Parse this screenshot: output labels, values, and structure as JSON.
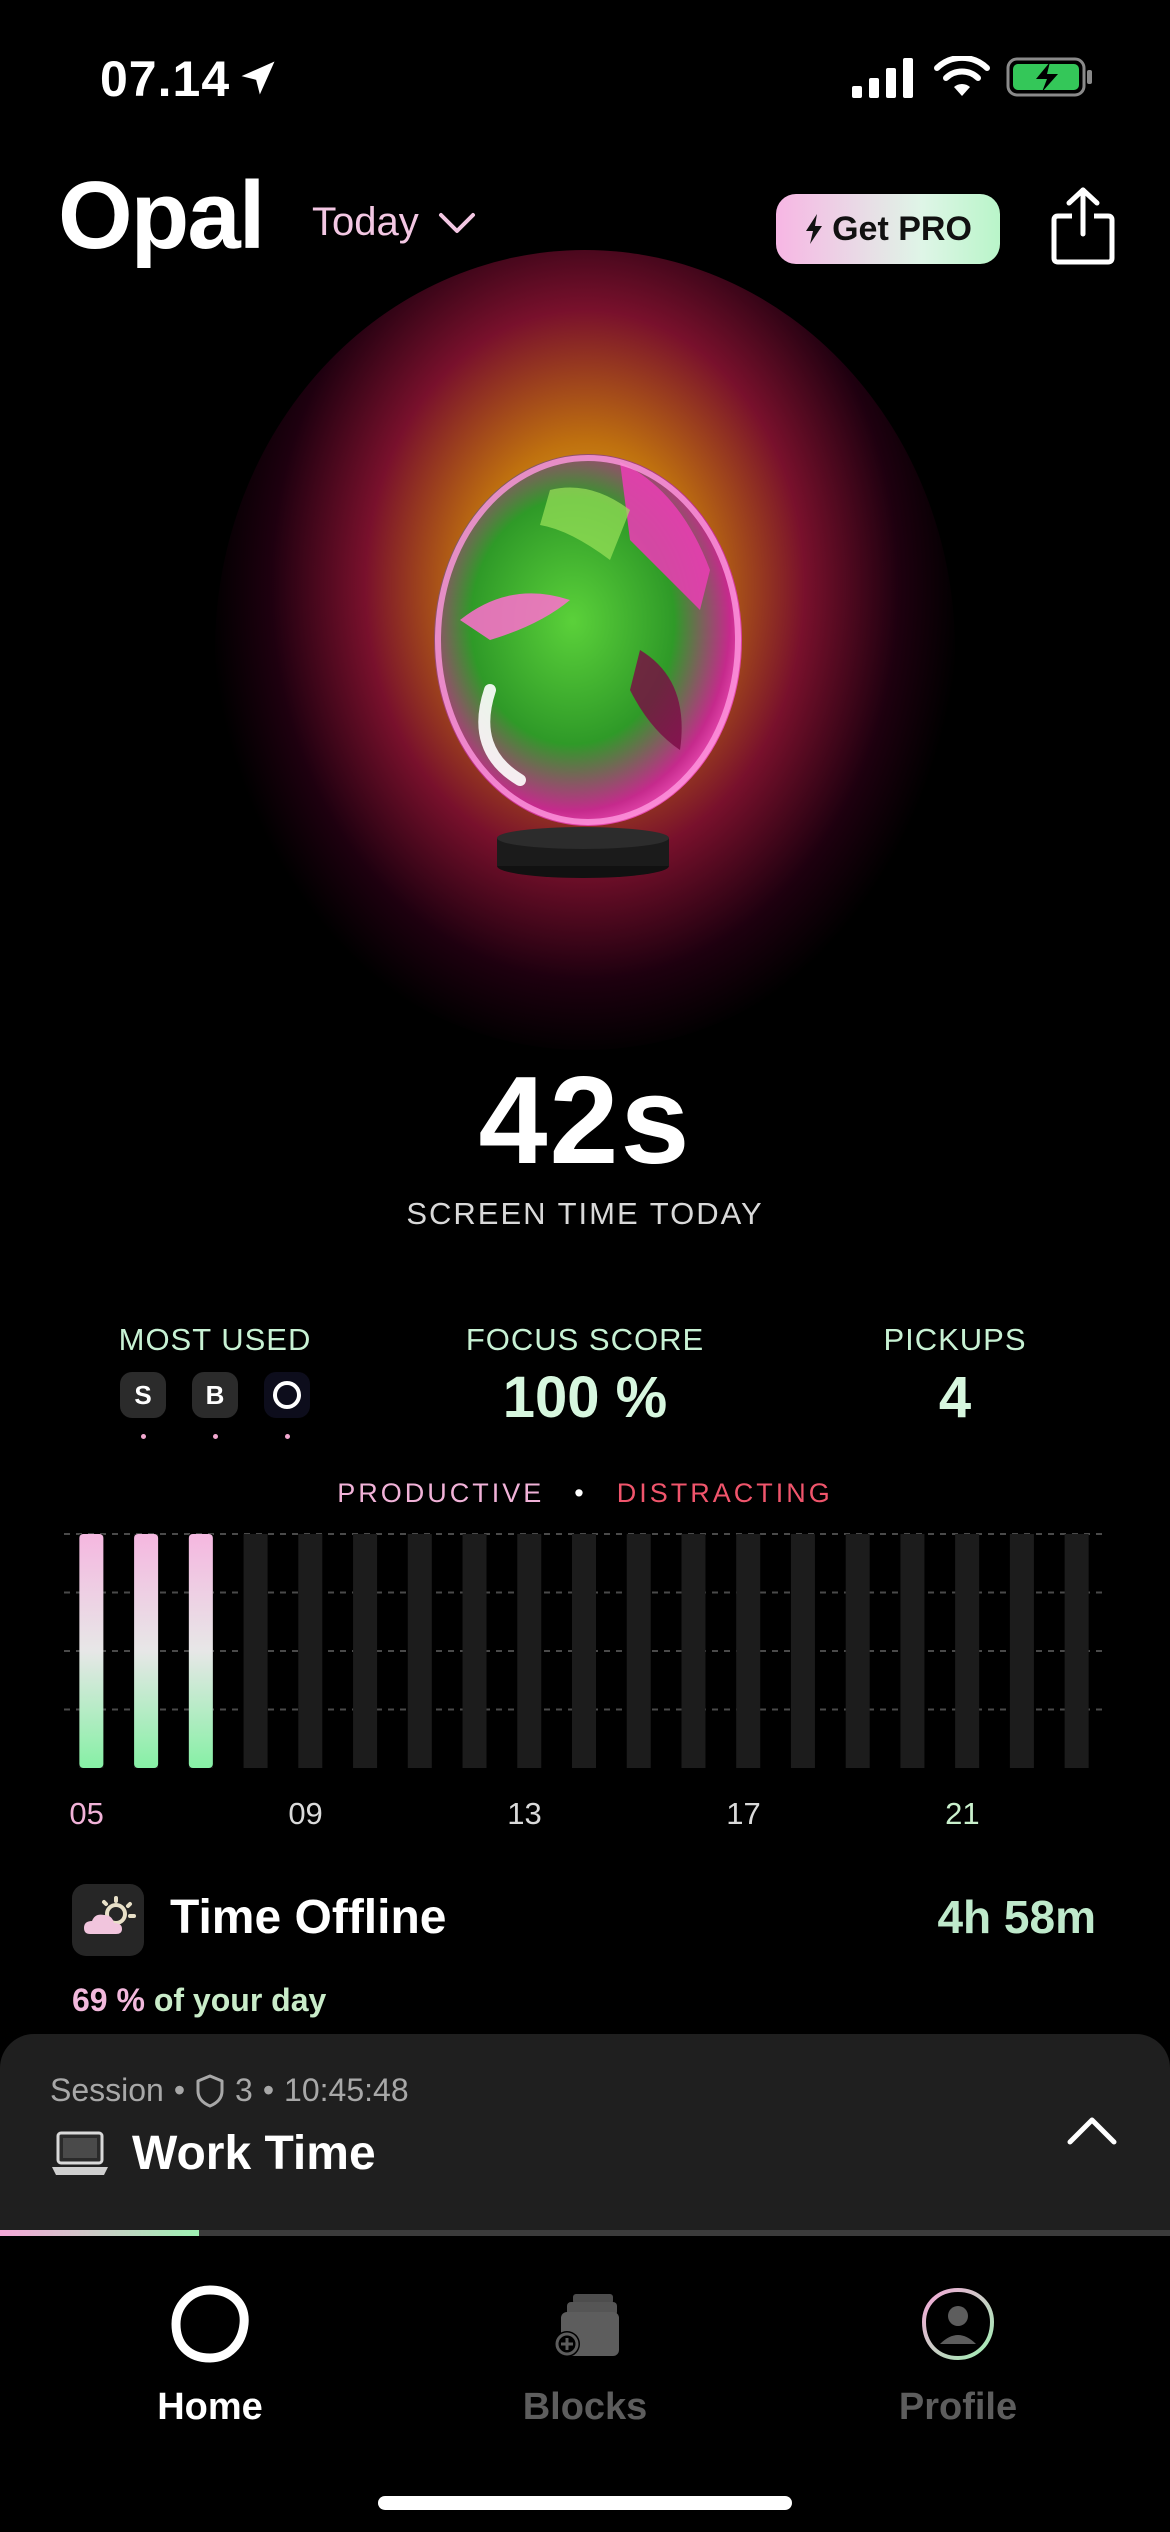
{
  "status_bar": {
    "time": "07.14"
  },
  "header": {
    "logo": "Opal",
    "range": "Today",
    "pro_button": "Get PRO"
  },
  "hero": {
    "screen_time": "42s",
    "screen_time_label": "SCREEN TIME TODAY"
  },
  "stats": {
    "most_used_label": "MOST USED",
    "most_used_apps": [
      "S",
      "B"
    ],
    "focus_label": "FOCUS SCORE",
    "focus_value": "100 %",
    "pickups_label": "PICKUPS",
    "pickups_value": "4"
  },
  "legend": {
    "productive": "PRODUCTIVE",
    "separator": "•",
    "distracting": "DISTRACTING"
  },
  "chart_data": {
    "type": "bar",
    "categories": [
      "05",
      "06",
      "07",
      "08",
      "09",
      "10",
      "11",
      "12",
      "13",
      "14",
      "15",
      "16",
      "17",
      "18",
      "19",
      "20",
      "21",
      "22",
      "23"
    ],
    "values": [
      1,
      1,
      1,
      0,
      0,
      0,
      0,
      0,
      0,
      0,
      0,
      0,
      0,
      0,
      0,
      0,
      0,
      0,
      0
    ],
    "tick_labels": [
      "05",
      "09",
      "13",
      "17",
      "21"
    ],
    "colors": {
      "top": "#f5b7e0",
      "mid": "#e7e7e7",
      "bottom": "#86f0a5",
      "empty": "#1c1c1c"
    }
  },
  "offline": {
    "title": "Time Offline",
    "value": "4h 58m",
    "percent": "69 %",
    "rest": "of your day"
  },
  "session": {
    "prefix": "Session",
    "dot": "•",
    "count": "3",
    "time": "10:45:48",
    "name": "Work Time",
    "progress": 0.17
  },
  "tabs": [
    {
      "label": "Home",
      "active": true
    },
    {
      "label": "Blocks",
      "active": false
    },
    {
      "label": "Profile",
      "active": false
    }
  ],
  "colors": {
    "accent_pink": "#f5a7d8",
    "accent_green": "#9ff1b3",
    "inactive": "#5d5d5d"
  }
}
